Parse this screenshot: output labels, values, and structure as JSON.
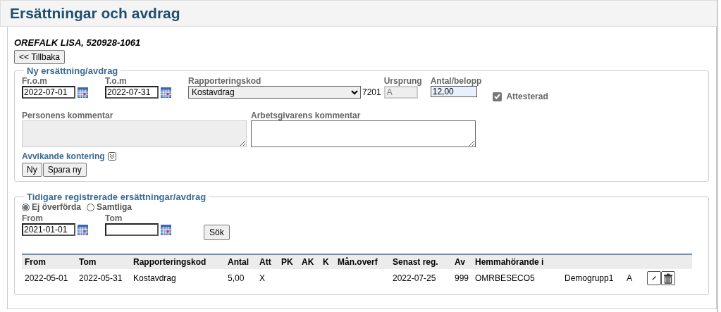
{
  "page": {
    "title": "Ersättningar och avdrag"
  },
  "person": "OREFALK LISA, 520928-1061",
  "back_button": "<< Tillbaka",
  "new_entry": {
    "legend": "Ny ersättning/avdrag",
    "from": {
      "label": "Fr.o.m",
      "value": "2022-07-01"
    },
    "to": {
      "label": "T.o.m",
      "value": "2022-07-31"
    },
    "report_code": {
      "label": "Rapporteringskod",
      "value": "Kostavdrag",
      "code": "7201"
    },
    "origin": {
      "label": "Ursprung",
      "value": "A",
      "disabled": true
    },
    "amount": {
      "label": "Antal/belopp",
      "value": "12,00"
    },
    "attested": {
      "label": "Attesterad",
      "checked": true,
      "disabled": true
    },
    "person_comment": {
      "label": "Personens kommentar",
      "disabled": true
    },
    "employer_comment": {
      "label": "Arbetsgivarens kommentar",
      "disabled": false
    },
    "deviating_account": {
      "label": "Avvikande kontering",
      "expanded": false
    },
    "buttons": [
      "Ny",
      "Spara ny"
    ]
  },
  "history": {
    "legend": "Tidigare registrerade ersättningar/avdrag",
    "filters": [
      {
        "label": "Ej överförda",
        "selected": true
      },
      {
        "label": "Samtliga",
        "selected": false
      }
    ],
    "from": {
      "label": "From",
      "value": "2021-01-01"
    },
    "to": {
      "label": "Tom"
    },
    "search_button": "Sök",
    "table": {
      "columns": [
        "From",
        "Tom",
        "Rapporteringskod",
        "Antal",
        "Att",
        "PK",
        "AK",
        "K",
        "Mån.overf",
        "Senast reg.",
        "Av",
        "Hemmahörande i",
        null,
        null
      ],
      "rows": [
        {
          "cells": [
            "2022-05-01",
            "2022-05-31",
            "Kostavdrag",
            "5,00",
            "X",
            null,
            null,
            null,
            null,
            "2022-07-25",
            "999",
            "OMRBESECO5",
            "Demogrupp1",
            "A"
          ]
        }
      ]
    }
  }
}
